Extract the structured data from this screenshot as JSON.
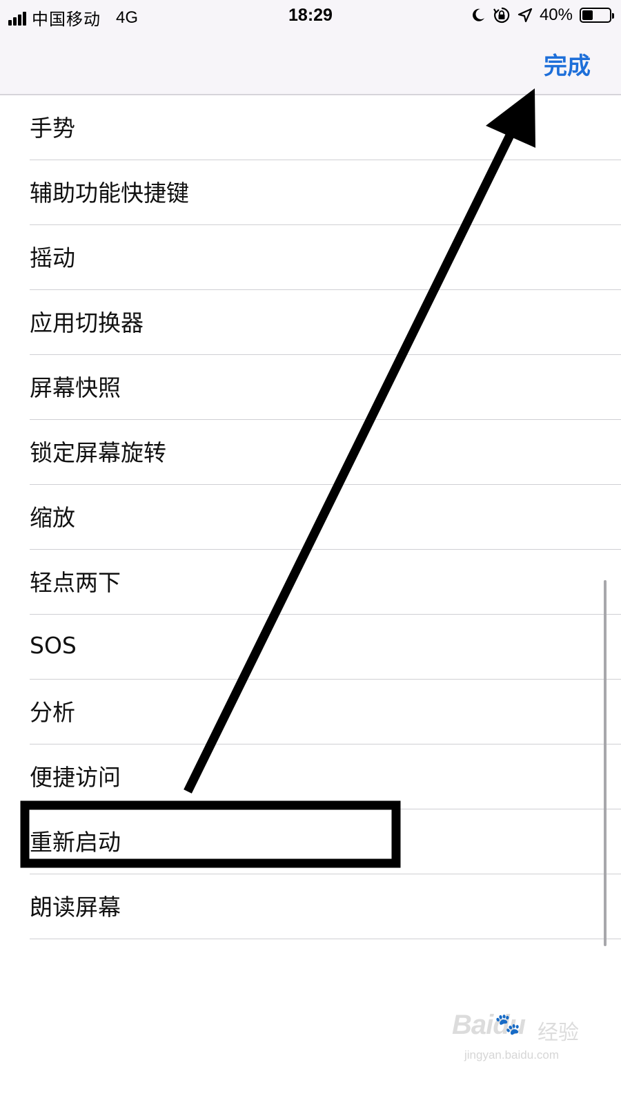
{
  "status_bar": {
    "carrier": "中国移动",
    "network": "4G",
    "time": "18:29",
    "battery_percent": "40%",
    "battery_level": 0.4,
    "icons": [
      "signal-icon",
      "moon-icon",
      "rotation-lock-icon",
      "location-icon",
      "battery-icon"
    ]
  },
  "nav": {
    "done_label": "完成",
    "accent_color": "#1e6fd9"
  },
  "menu": {
    "items": [
      {
        "label": "手势"
      },
      {
        "label": "辅助功能快捷键"
      },
      {
        "label": "摇动"
      },
      {
        "label": "应用切换器"
      },
      {
        "label": "屏幕快照"
      },
      {
        "label": "锁定屏幕旋转"
      },
      {
        "label": "缩放"
      },
      {
        "label": "轻点两下"
      },
      {
        "label": "SOS"
      },
      {
        "label": "分析"
      },
      {
        "label": "便捷访问"
      },
      {
        "label": "重新启动"
      },
      {
        "label": "朗读屏幕"
      }
    ],
    "highlighted_index": 11
  },
  "watermark": {
    "brand": "Baidu",
    "cn": "经验",
    "url": "jingyan.baidu.com"
  }
}
